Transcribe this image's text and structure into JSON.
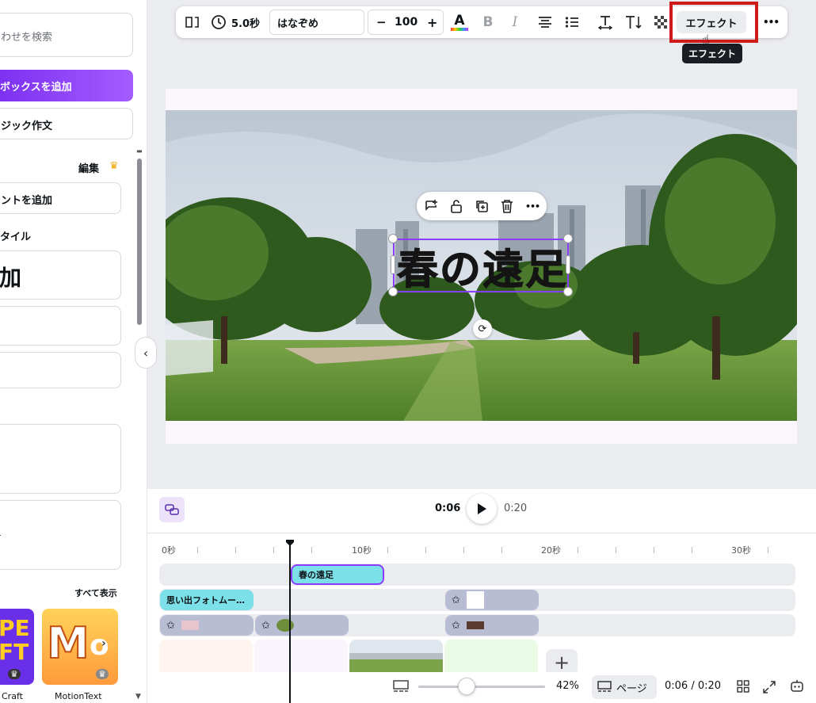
{
  "left_panel": {
    "search_placeholder": "わせを検索",
    "add_textbox_label": "ボックスを追加",
    "magic_write_label": "ジック作文",
    "edit_label": "編集",
    "add_font_label": "ントを追加",
    "style_heading": "タイル",
    "heading_sample": "加",
    "show_all_label": "すべて表示",
    "thumb1_caption": "Craft",
    "thumb2_caption": "MotionText"
  },
  "toolbar": {
    "duration": "5.0秒",
    "font_name": "はなぞめ",
    "font_size": "100",
    "minus": "−",
    "plus": "+",
    "bold": "B",
    "italic": "I",
    "effect_label": "エフェクト",
    "more": "•••"
  },
  "tooltip": "エフェクト",
  "canvas": {
    "title_text": "春の遠足"
  },
  "timeline": {
    "current_time": "0:06",
    "total_time": "0:20",
    "ticks": [
      "0秒",
      "10秒",
      "20秒",
      "30秒"
    ],
    "text_clip": "春の遠足",
    "photo_clip": "思い出フォトムー…"
  },
  "bottom_bar": {
    "zoom": "42%",
    "page_label": "ページ",
    "time_readout": "0:06 / 0:20"
  },
  "colors": {
    "accent": "#8b3dff",
    "highlight": "#d01a1a",
    "clip_cyan": "#7be0e8",
    "clip_gray": "#b9bdd4"
  }
}
